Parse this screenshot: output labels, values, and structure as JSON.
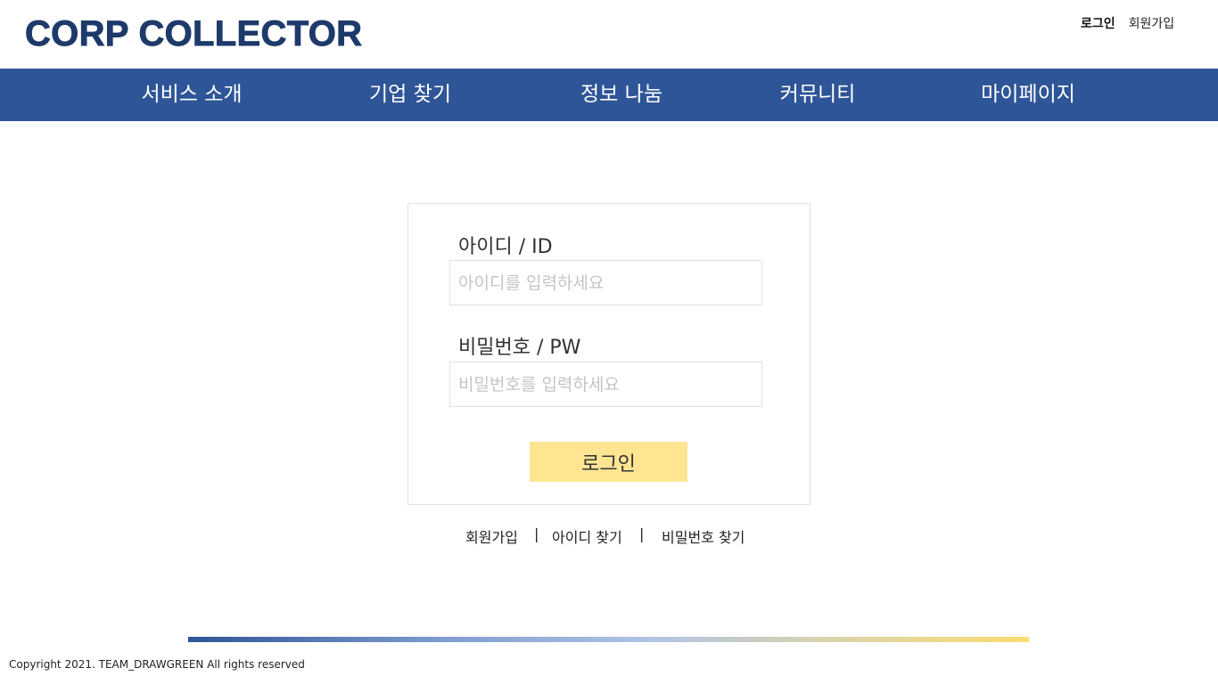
{
  "header": {
    "logo_text": "CORP COLLECTOR",
    "top_links": {
      "login": "로그인",
      "signup": "회원가입"
    }
  },
  "nav": {
    "items": [
      {
        "label": "서비스 소개"
      },
      {
        "label": "기업 찾기"
      },
      {
        "label": "정보 나눔"
      },
      {
        "label": "커뮤니티"
      },
      {
        "label": "마이페이지"
      }
    ]
  },
  "login_form": {
    "id_label": "아이디 / ID",
    "id_placeholder": "아이디를 입력하세요",
    "pw_label": "비밀번호 / PW",
    "pw_placeholder": "비밀번호를 입력하세요",
    "submit_label": "로그인"
  },
  "bottom_links": {
    "signup": "회원가입",
    "find_id": "아이디 찾기",
    "find_pw": "비밀번호 찾기",
    "separator": "|"
  },
  "footer": {
    "copyright": "Copyright 2021. TEAM_DRAWGREEN All rights reserved"
  },
  "colors": {
    "brand_navy": "#1e3a6b",
    "nav_blue": "#2e5597",
    "button_yellow": "#ffe492",
    "gradient_end": "#fadc72"
  }
}
